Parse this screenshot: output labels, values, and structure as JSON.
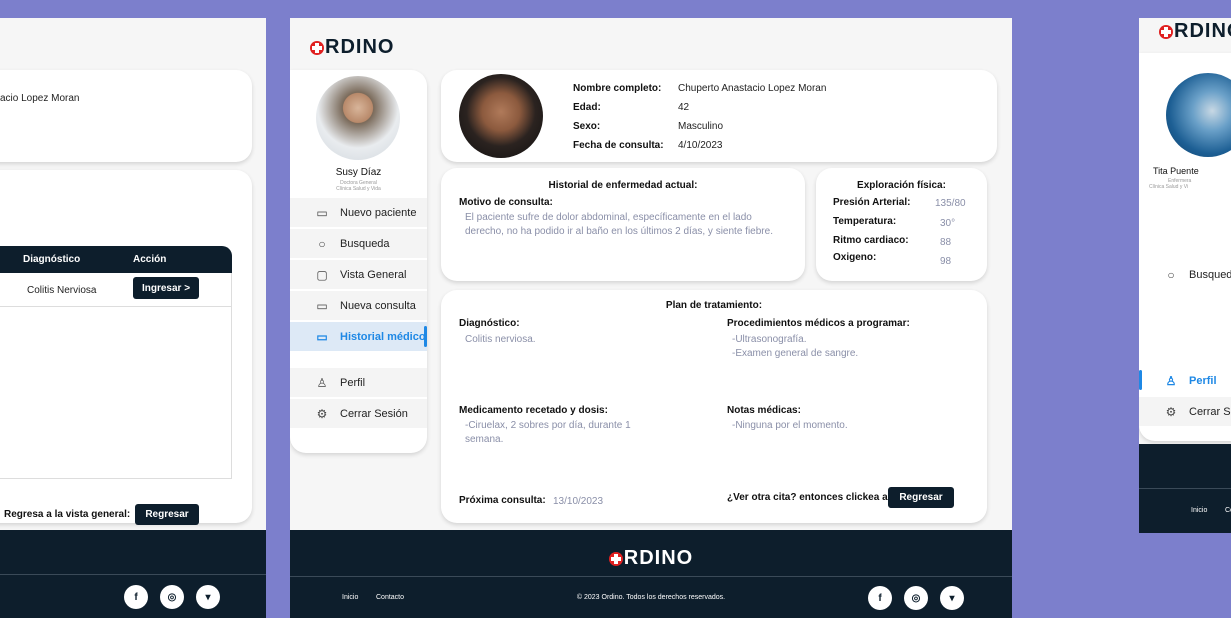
{
  "brand": {
    "name": "RDINO"
  },
  "left_screen": {
    "patient_name_fragment": "acio Lopez Moran",
    "table": {
      "headers": [
        "Diagnóstico",
        "Acción"
      ],
      "row": {
        "diagnosis": "Colitis Nerviosa",
        "action": "Ingresar >"
      }
    },
    "back_label": "Regresa a la vista general:",
    "back_button": "Regresar",
    "social": [
      "f",
      "◎",
      "▾"
    ]
  },
  "center_screen": {
    "doctor": {
      "name": "Susy Díaz",
      "role": "Doctora General",
      "clinic": "Clínica Salud y Vida"
    },
    "menu": [
      {
        "label": "Nuevo paciente",
        "icon": "id-card-icon"
      },
      {
        "label": "Busqueda",
        "icon": "search-icon"
      },
      {
        "label": "Vista General",
        "icon": "user-square-icon"
      },
      {
        "label": "Nueva consulta",
        "icon": "id-card-plus-icon"
      },
      {
        "label": "Historial médico",
        "icon": "id-card-icon",
        "active": true
      },
      {
        "label": "Perfil",
        "icon": "user-icon"
      },
      {
        "label": "Cerrar Sesión",
        "icon": "gear-icon"
      }
    ],
    "patient": {
      "name_label": "Nombre completo:",
      "name": "Chuperto Anastacio Lopez Moran",
      "age_label": "Edad:",
      "age": "42",
      "sex_label": "Sexo:",
      "sex": "Masculino",
      "date_label": "Fecha de consulta:",
      "date": "4/10/2023"
    },
    "history": {
      "title": "Historial de enfermedad actual:",
      "reason_label": "Motivo de consulta:",
      "reason": "El paciente sufre de dolor abdominal, específicamente en el lado derecho, no ha podido ir al baño en los últimos 2 días, y siente fiebre."
    },
    "exam": {
      "title": "Exploración física:",
      "rows": [
        {
          "label": "Presión Arterial:",
          "value": "135/80"
        },
        {
          "label": "Temperatura:",
          "value": "30°"
        },
        {
          "label": "Ritmo cardiaco:",
          "value": "88"
        },
        {
          "label": "Oxigeno:",
          "value": "98"
        }
      ]
    },
    "plan": {
      "title": "Plan de tratamiento:",
      "diagnosis_label": "Diagnóstico:",
      "diagnosis": "Colitis nerviosa.",
      "procedures_label": "Procedimientos médicos a programar:",
      "procedures": [
        "-Ultrasonografía.",
        "-Examen general de sangre."
      ],
      "medication_label": "Medicamento recetado y dosis:",
      "medication": "-Ciruelax, 2 sobres por día, durante 1 semana.",
      "notes_label": "Notas médicas:",
      "notes": "-Ninguna por el momento.",
      "next_label": "Próxima consulta:",
      "next_date": "13/10/2023",
      "another_label": "¿Ver otra cita? entonces clickea a:",
      "another_button": "Regresar"
    },
    "footer": {
      "links": [
        "Inicio",
        "Contacto"
      ],
      "copyright": "© 2023 Ordino. Todos los derechos reservados.",
      "social": [
        "f",
        "◎",
        "▾"
      ]
    }
  },
  "right_screen": {
    "nurse": {
      "name": "Tita Puente",
      "role": "Enfermera",
      "clinic": "Clínica Salud y Vi"
    },
    "menu": [
      {
        "label": "Busqueda"
      },
      {
        "label": "Perfil"
      },
      {
        "label": "Cerrar Ses"
      }
    ],
    "footer": {
      "links": [
        "Inicio",
        "Co"
      ]
    }
  },
  "colors": {
    "background": "#7c7fcc",
    "dark": "#0d1e2c",
    "accent": "#1e88e5",
    "logo_red": "#e02020"
  }
}
